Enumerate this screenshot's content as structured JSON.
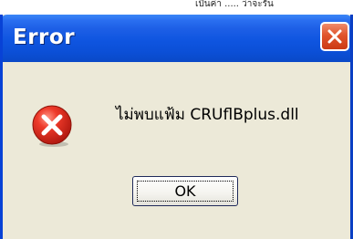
{
  "background_fragment": {
    "text": "เป็นค่า ..... ว่าจะรัน"
  },
  "dialog": {
    "title": "Error",
    "message": "ไม่พบแฟ้ม  CRUflBplus.dll",
    "ok_label": "OK",
    "icon": "error-icon",
    "colors": {
      "titlebar": "#0b4fd6",
      "body": "#ece9d8",
      "close_button": "#e0542c",
      "error_icon": "#d8261b"
    }
  }
}
